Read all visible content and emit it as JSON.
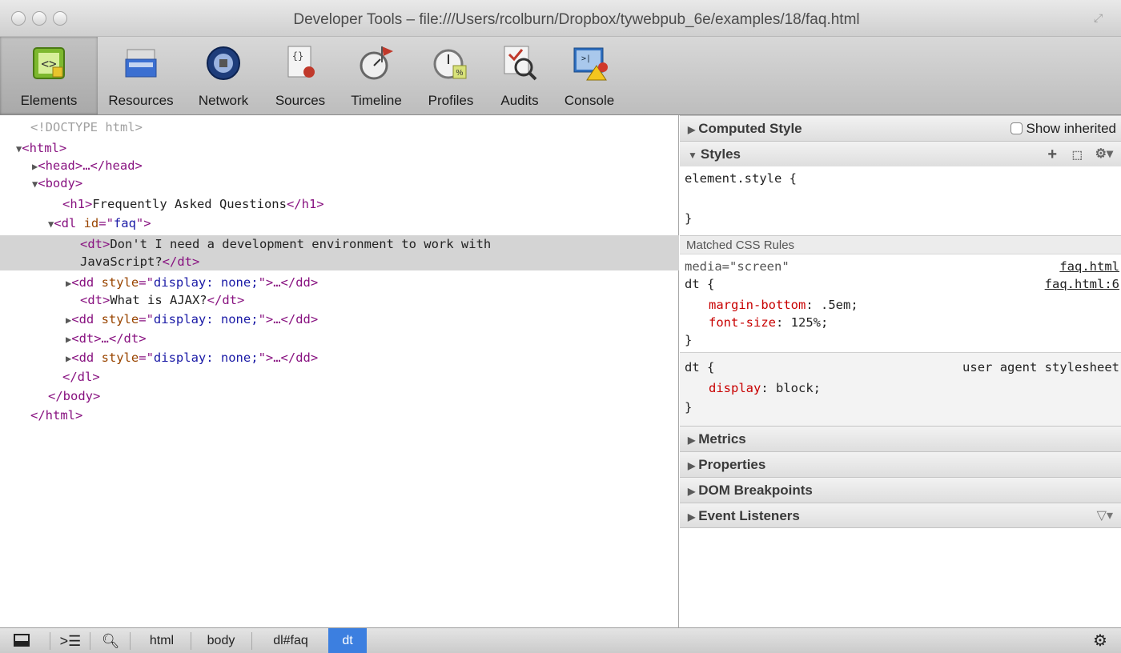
{
  "window": {
    "title": "Developer Tools – file:///Users/rcolburn/Dropbox/tywebpub_6e/examples/18/faq.html"
  },
  "toolbar": {
    "tabs": [
      {
        "label": "Elements",
        "icon": "elements-icon",
        "active": true
      },
      {
        "label": "Resources",
        "icon": "resources-icon"
      },
      {
        "label": "Network",
        "icon": "network-icon"
      },
      {
        "label": "Sources",
        "icon": "sources-icon"
      },
      {
        "label": "Timeline",
        "icon": "timeline-icon"
      },
      {
        "label": "Profiles",
        "icon": "profiles-icon"
      },
      {
        "label": "Audits",
        "icon": "audits-icon"
      },
      {
        "label": "Console",
        "icon": "console-icon"
      }
    ]
  },
  "dom": {
    "lines": [
      {
        "text": "<!DOCTYPE html>"
      },
      {
        "tri": "▼",
        "text": "<html>"
      },
      {
        "tri": "▶",
        "text": "<head>…</head>"
      },
      {
        "tri": "▼",
        "text": "<body>"
      },
      {
        "open": "<h1>",
        "content": "Frequently Asked Questions",
        "close": "</h1>"
      },
      {
        "tri": "▼",
        "open": "<dl ",
        "attr": "id",
        "eq": "=\"",
        "val": "faq",
        "end": "\">"
      },
      {
        "open": "<dt>",
        "content": "Don't I need a development environment to work with"
      },
      {
        "content": "JavaScript?",
        "close": "</dt>"
      },
      {
        "tri": "▶",
        "open": "<dd ",
        "attr": "style",
        "eq": "=\"",
        "val": "display: none;",
        "end": "\">…</dd>"
      },
      {
        "open": "<dt>",
        "content": "What is AJAX?",
        "close": "</dt>"
      },
      {
        "tri": "▶",
        "open": "<dd ",
        "attr": "style",
        "eq": "=\"",
        "val": "display: none;",
        "end": "\">…</dd>"
      },
      {
        "tri": "▶",
        "open": "<dt>…</dt>"
      },
      {
        "tri": "▶",
        "open": "<dd ",
        "attr": "style",
        "eq": "=\"",
        "val": "display: none;",
        "end": "\">…</dd>"
      },
      {
        "open": "</dl>"
      },
      {
        "open": "</body>"
      },
      {
        "open": "</html>"
      }
    ]
  },
  "sidebar": {
    "computed_style": "Computed Style",
    "show_inherited": "Show inherited",
    "styles": "Styles",
    "element_style_open": "element.style {",
    "close_brace": "}",
    "matched_rules": "Matched CSS Rules",
    "rule1_media": "media=\"screen\"",
    "rule1_source_top": "faq.html",
    "rule1_selector": "dt {",
    "rule1_source": "faq.html:6",
    "rule1_prop1": "margin-bottom",
    "rule1_val1": ": .5em;",
    "rule1_prop2": "font-size",
    "rule1_val2": ": 125%;",
    "rule2_selector": "dt {",
    "rule2_source": "user agent stylesheet",
    "rule2_prop1": "display",
    "rule2_val1": ": block;",
    "metrics": "Metrics",
    "properties": "Properties",
    "dom_breakpoints": "DOM Breakpoints",
    "event_listeners": "Event Listeners"
  },
  "statusbar": {
    "crumbs": [
      "html",
      "body",
      "dl#faq",
      "dt"
    ]
  }
}
